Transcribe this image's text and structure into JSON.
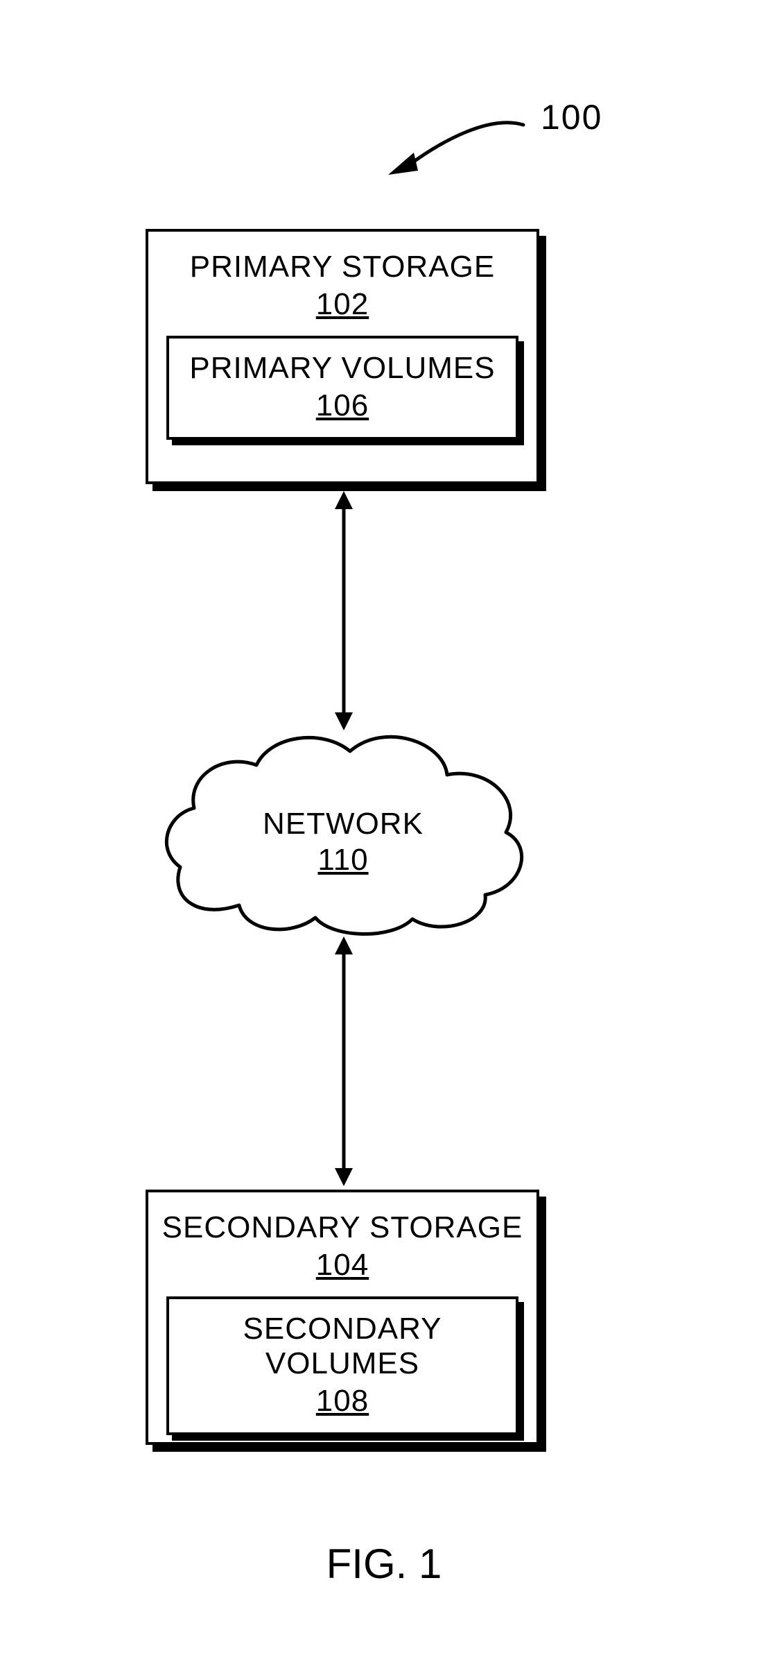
{
  "figure": {
    "ref_number": "100",
    "primary_storage": {
      "title": "PRIMARY STORAGE",
      "number": "102",
      "inner_title": "PRIMARY VOLUMES",
      "inner_number": "106"
    },
    "network": {
      "title": "NETWORK",
      "number": "110"
    },
    "secondary_storage": {
      "title": "SECONDARY STORAGE",
      "number": "104",
      "inner_title": "SECONDARY VOLUMES",
      "inner_number": "108"
    },
    "caption": "FIG. 1"
  }
}
